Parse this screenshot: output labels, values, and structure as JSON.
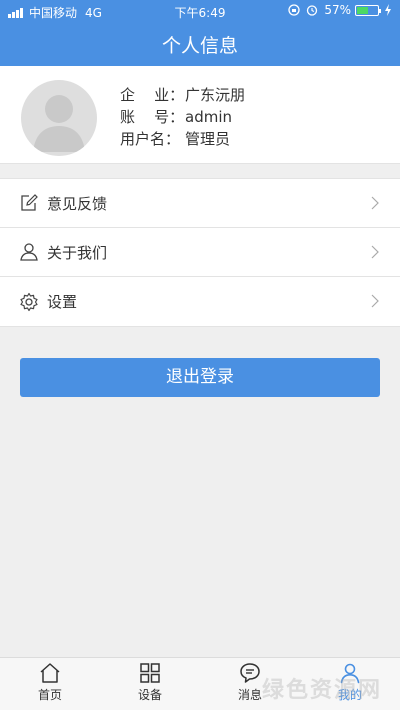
{
  "status_bar": {
    "carrier": "中国移动",
    "network": "4G",
    "time": "下午6:49",
    "battery_percent": "57%",
    "battery_level": 0.57,
    "icons": [
      "signal-icon",
      "rotation-lock-icon",
      "alarm-icon",
      "battery-icon",
      "charging-icon"
    ]
  },
  "header": {
    "title": "个人信息"
  },
  "profile": {
    "company_label": "企    业：",
    "company": "广东沅朋",
    "account_label": "账    号：",
    "account": "admin",
    "username_label": "用户名：",
    "username": "管理员"
  },
  "menu": {
    "items": [
      {
        "label": "意见反馈",
        "icon": "feedback-edit-icon"
      },
      {
        "label": "关于我们",
        "icon": "user-outline-icon"
      },
      {
        "label": "设置",
        "icon": "gear-icon"
      }
    ]
  },
  "logout_label": "退出登录",
  "tabbar": {
    "tabs": [
      {
        "label": "首页",
        "icon": "home-icon"
      },
      {
        "label": "设备",
        "icon": "grid-icon"
      },
      {
        "label": "消息",
        "icon": "chat-bubble-icon"
      },
      {
        "label": "我的",
        "icon": "user-icon",
        "active": true
      }
    ]
  },
  "watermark": "绿色资源网",
  "colors": {
    "primary": "#4a90e2",
    "background": "#efefef",
    "battery": "#4cd964"
  }
}
